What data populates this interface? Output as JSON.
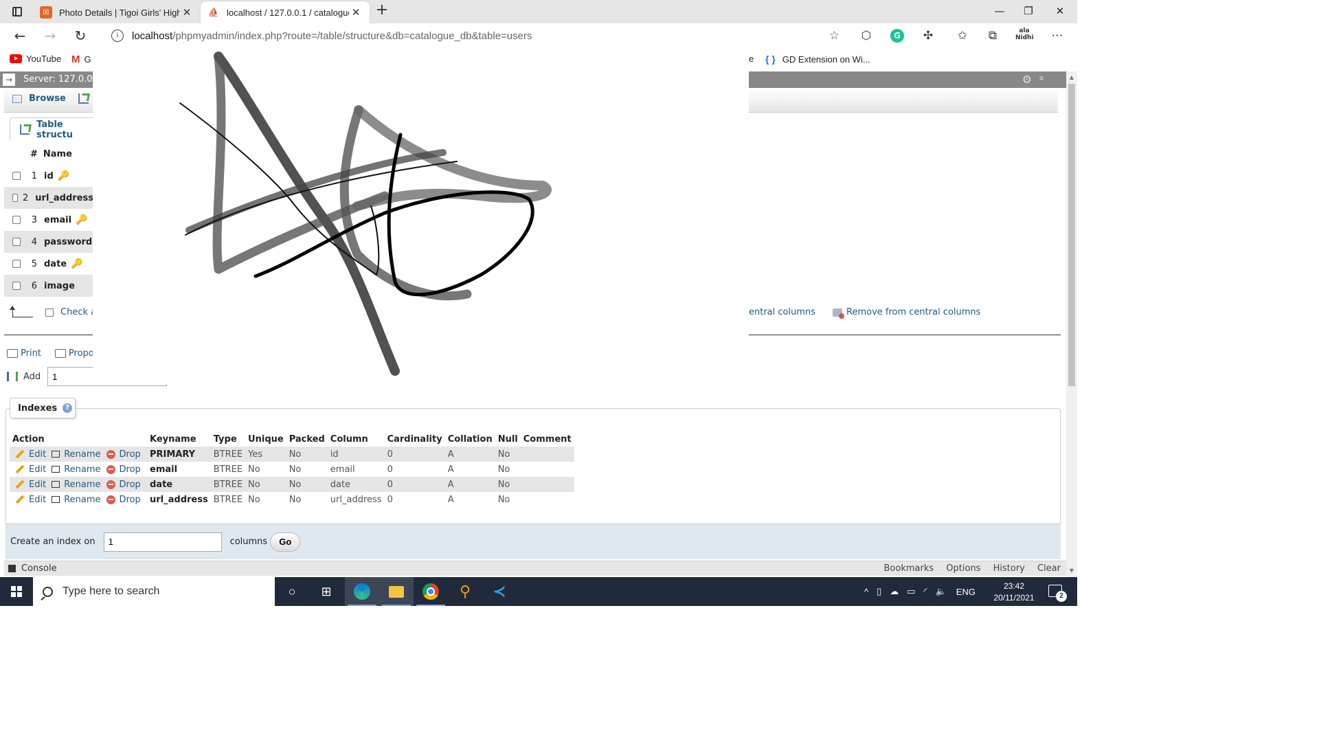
{
  "browser": {
    "tabs": [
      {
        "title": "Photo Details | Tigoi Girls' High S",
        "active": false
      },
      {
        "title": "localhost / 127.0.0.1 / catalogue_",
        "active": true
      }
    ],
    "url_host": "localhost",
    "url_path": "/phpmyadmin/index.php?route=/table/structure&db=catalogue_db&table=users",
    "bookmarks": [
      "YouTube",
      "G",
      "e",
      "GD Extension on Wi..."
    ],
    "profile_label": "ala\nNidhi"
  },
  "pma": {
    "server_label": "Server: 127.0.0",
    "tabs": [
      "Browse"
    ],
    "subtab": "Table structu",
    "structure": {
      "headers": [
        "#",
        "Name"
      ],
      "rows": [
        {
          "num": "1",
          "name": "id",
          "key": "primary"
        },
        {
          "num": "2",
          "name": "url_address",
          "key": ""
        },
        {
          "num": "3",
          "name": "email",
          "key": "index"
        },
        {
          "num": "4",
          "name": "password",
          "key": ""
        },
        {
          "num": "5",
          "name": "date",
          "key": "index"
        },
        {
          "num": "6",
          "name": "image",
          "key": ""
        }
      ],
      "check_all": "Check a",
      "central_add": "entral columns",
      "central_remove": "Remove from central columns"
    },
    "print": "Print",
    "propose": "Propo",
    "add_label": "Add",
    "add_value": "1",
    "indexes": {
      "legend": "Indexes",
      "headers": [
        "Action",
        "Keyname",
        "Type",
        "Unique",
        "Packed",
        "Column",
        "Cardinality",
        "Collation",
        "Null",
        "Comment"
      ],
      "actions": {
        "edit": "Edit",
        "rename": "Rename",
        "drop": "Drop"
      },
      "rows": [
        {
          "keyname": "PRIMARY",
          "type": "BTREE",
          "unique": "Yes",
          "packed": "No",
          "column": "id",
          "cardinality": "0",
          "collation": "A",
          "null": "No",
          "comment": ""
        },
        {
          "keyname": "email",
          "type": "BTREE",
          "unique": "No",
          "packed": "No",
          "column": "email",
          "cardinality": "0",
          "collation": "A",
          "null": "No",
          "comment": ""
        },
        {
          "keyname": "date",
          "type": "BTREE",
          "unique": "No",
          "packed": "No",
          "column": "date",
          "cardinality": "0",
          "collation": "A",
          "null": "No",
          "comment": ""
        },
        {
          "keyname": "url_address",
          "type": "BTREE",
          "unique": "No",
          "packed": "No",
          "column": "url_address",
          "cardinality": "0",
          "collation": "A",
          "null": "No",
          "comment": ""
        }
      ],
      "create_label": "Create an index on",
      "create_value": "1",
      "columns_label": "columns",
      "go": "Go"
    },
    "console": "Console",
    "console_links": [
      "Bookmarks",
      "Options",
      "History",
      "Clear"
    ]
  },
  "taskbar": {
    "search_placeholder": "Type here to search",
    "lang": "ENG",
    "time": "23:42",
    "date": "20/11/2021",
    "notifications": "2"
  }
}
